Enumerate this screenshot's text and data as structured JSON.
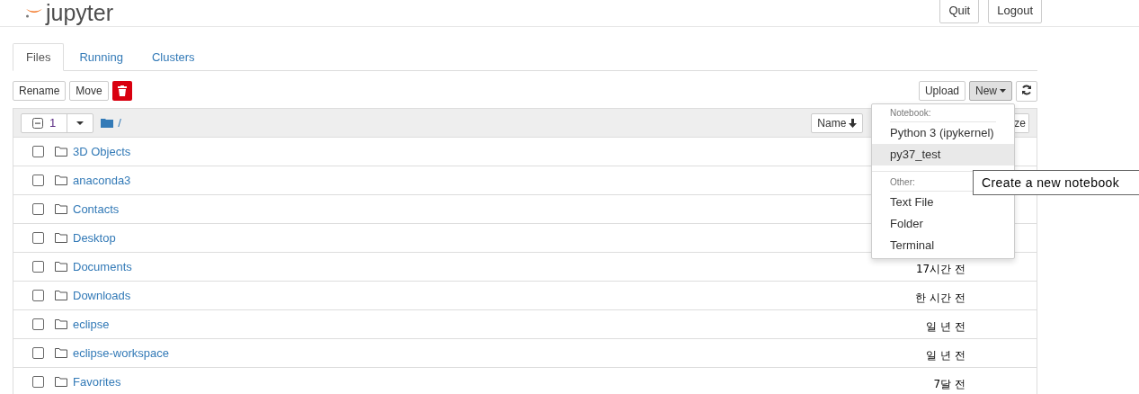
{
  "header": {
    "logo_text": "jupyter",
    "buttons": [
      "Quit",
      "Logout"
    ]
  },
  "tabs": [
    {
      "label": "Files",
      "selected": true
    },
    {
      "label": "Running",
      "selected": false
    },
    {
      "label": "Clusters",
      "selected": false
    }
  ],
  "toolbar": {
    "left_buttons": [
      "Rename",
      "Move"
    ],
    "right_buttons": [
      "Upload",
      "New"
    ]
  },
  "list_header": {
    "select_all_partial": true,
    "selected_count": "1",
    "path": "/",
    "sort_buttons": [
      "Name",
      "ze"
    ]
  },
  "rows": [
    {
      "name": "3D Objects",
      "checked": false,
      "modified": ""
    },
    {
      "name": "anaconda3",
      "checked": false,
      "modified": ""
    },
    {
      "name": "Contacts",
      "checked": false,
      "modified": ""
    },
    {
      "name": "Desktop",
      "checked": false,
      "modified": ""
    },
    {
      "name": "Documents",
      "checked": false,
      "modified": "17시간 전"
    },
    {
      "name": "Downloads",
      "checked": false,
      "modified": "한 시간 전"
    },
    {
      "name": "eclipse",
      "checked": false,
      "modified": "일 년 전"
    },
    {
      "name": "eclipse-workspace",
      "checked": false,
      "modified": "일 년 전"
    },
    {
      "name": "Favorites",
      "checked": false,
      "modified": "7달 전"
    }
  ],
  "new_menu": {
    "sections": [
      {
        "heading": "Notebook:",
        "items": [
          {
            "label": "Python 3 (ipykernel)",
            "selected": false
          },
          {
            "label": "py37_test",
            "selected": true
          }
        ]
      },
      {
        "heading": "Other:",
        "items": [
          {
            "label": "Text File",
            "selected": false
          },
          {
            "label": "Folder",
            "selected": false
          },
          {
            "label": "Terminal",
            "selected": false
          }
        ]
      }
    ]
  },
  "tooltip": "Create a new notebook"
}
